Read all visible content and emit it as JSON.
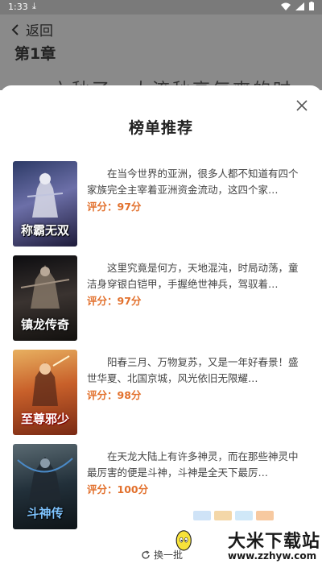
{
  "status_bar": {
    "time": "1:33"
  },
  "header": {
    "back_label": "返回"
  },
  "reader": {
    "chapter_title": "第1章",
    "text_line": "六秋了，大流秋高气爽的时"
  },
  "sheet": {
    "title": "榜单推荐",
    "books": [
      {
        "cover_title": "称霸无双",
        "description": "在当今世界的亚洲，很多人都不知道有四个家族完全主宰着亚洲资金流动，这四个家…",
        "score": "评分：97分"
      },
      {
        "cover_title": "镇龙传奇",
        "description": "这里究竟是何方，天地混沌，时局动荡，童洁身穿银白铠甲，手握绝世神兵，驾驭着…",
        "score": "评分：97分"
      },
      {
        "cover_title": "至尊邪少",
        "description": "阳春三月、万物复苏，又是一年好春景！盛世华夏、北国京城，风光依旧无限耀…",
        "score": "评分：98分"
      },
      {
        "cover_title": "斗神传",
        "description": "在天龙大陆上有许多神灵，而在那些神灵中最厉害的便是斗神，斗神是全天下最厉…",
        "score": "评分：100分"
      }
    ],
    "refresh_label": "换一批"
  },
  "watermark": {
    "name": "大米下载站",
    "url": "www.zzhyw.com"
  },
  "colors": {
    "score": "#e2702c",
    "overlay": "#8a8a8a"
  }
}
